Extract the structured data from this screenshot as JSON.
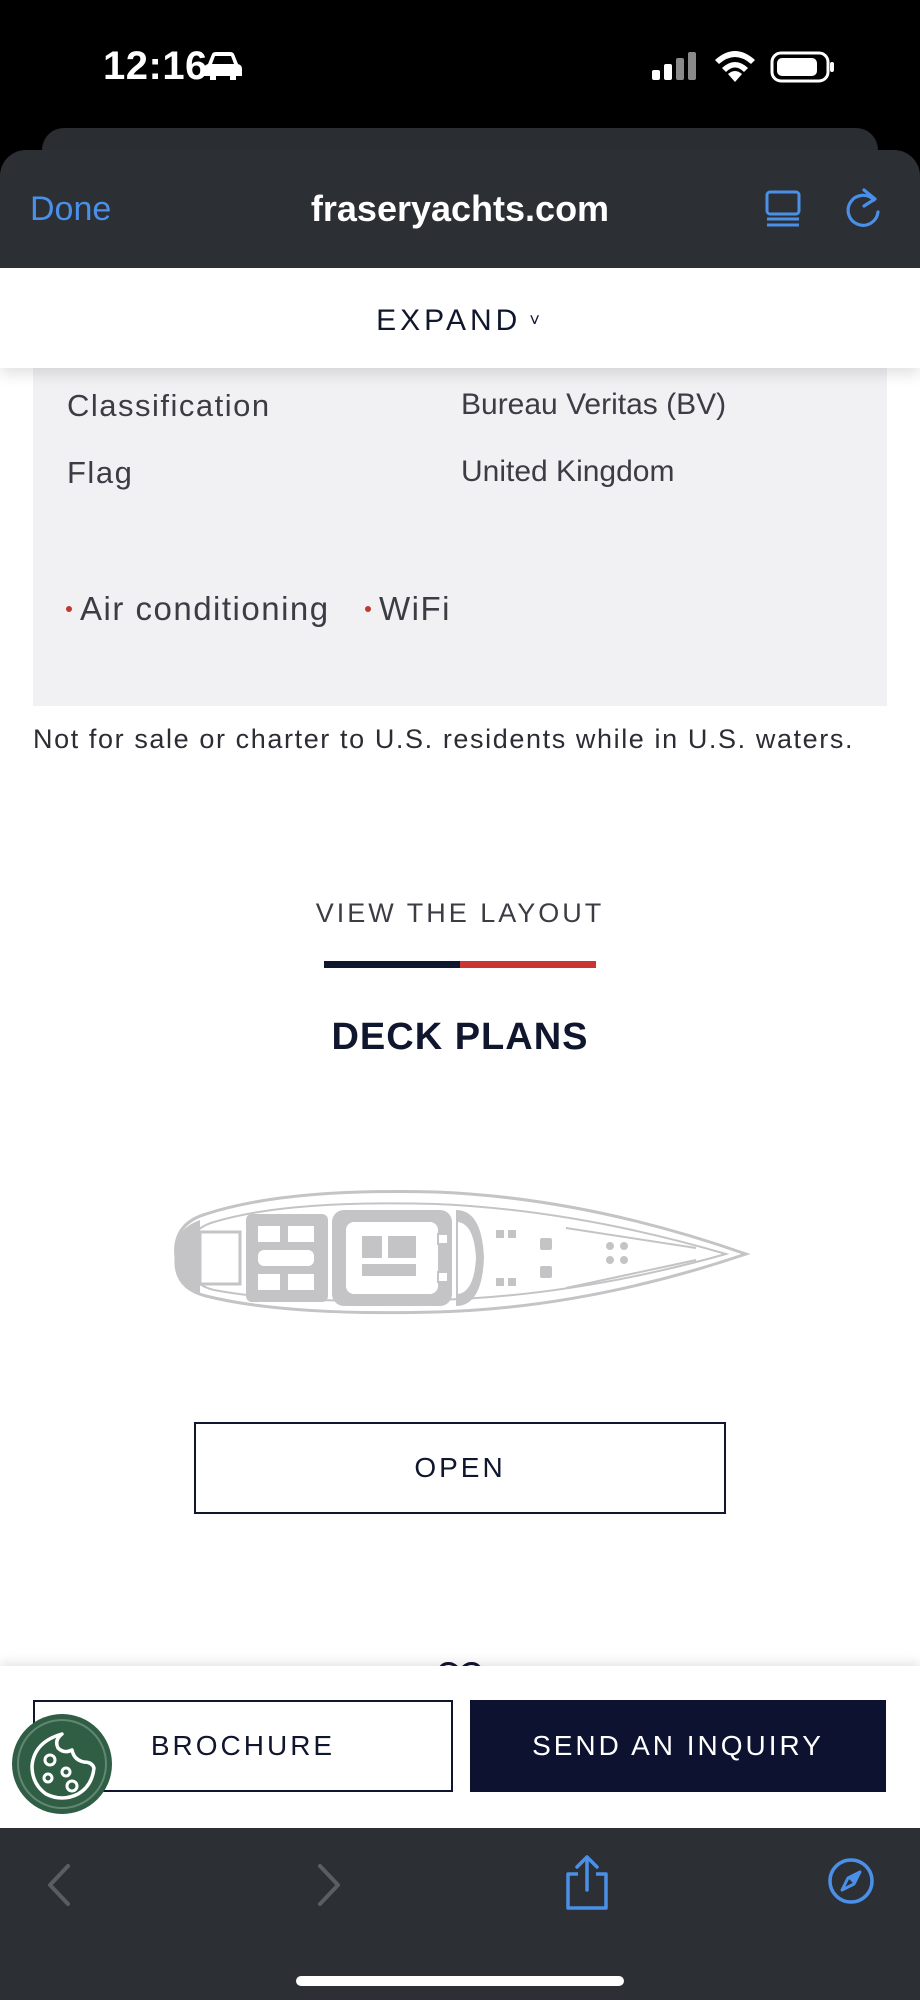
{
  "status_bar": {
    "time": "12:16"
  },
  "browser": {
    "done_label": "Done",
    "url": "fraseryachts.com"
  },
  "expand_bar": {
    "label": "EXPAND",
    "chevron": "˅"
  },
  "specs": [
    {
      "label": "Classification",
      "value": "Bureau Veritas (BV)"
    },
    {
      "label": "Flag",
      "value": "United Kingdom"
    }
  ],
  "amenities": [
    "Air conditioning",
    "WiFi"
  ],
  "disclaimer": "Not for sale or charter to U.S. residents while in U.S. waters.",
  "layout_section": {
    "kicker": "VIEW THE LAYOUT",
    "title": "DECK PLANS",
    "open_label": "OPEN"
  },
  "actions": {
    "brochure_label": "BROCHURE",
    "inquiry_label": "SEND AN INQUIRY"
  },
  "colors": {
    "navy": "#10162e",
    "accent_red": "#cc3333",
    "ios_blue": "#4a90e8",
    "cookie_green": "#2f5e45"
  },
  "icons": {
    "status": [
      "car-icon",
      "cellular-signal-icon",
      "wifi-icon",
      "battery-icon"
    ],
    "browser": [
      "reader-view-icon",
      "reload-icon"
    ],
    "toolbar": [
      "back-arrow-icon",
      "forward-arrow-icon",
      "share-icon",
      "safari-compass-icon"
    ],
    "page": [
      "cookie-icon",
      "heart-icon"
    ]
  }
}
